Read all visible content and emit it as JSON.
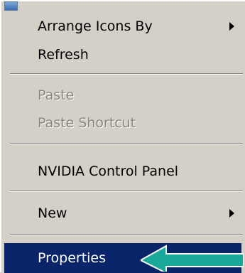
{
  "menu": {
    "items": [
      {
        "label": "Arrange Icons By",
        "has_submenu": true,
        "enabled": true
      },
      {
        "label": "Refresh",
        "has_submenu": false,
        "enabled": true
      },
      {
        "label": "Paste",
        "has_submenu": false,
        "enabled": false
      },
      {
        "label": "Paste Shortcut",
        "has_submenu": false,
        "enabled": false
      },
      {
        "label": "NVIDIA Control Panel",
        "has_submenu": false,
        "enabled": true
      },
      {
        "label": "New",
        "has_submenu": true,
        "enabled": true
      },
      {
        "label": "Properties",
        "has_submenu": false,
        "enabled": true,
        "highlighted": true
      }
    ]
  },
  "annotation": {
    "pointer_color": "#1aa89a",
    "icon": "arrow-left-icon"
  },
  "colors": {
    "menu_bg": "#d4d0c8",
    "selection_bg": "#0a246a",
    "disabled_text": "#8a8680"
  }
}
